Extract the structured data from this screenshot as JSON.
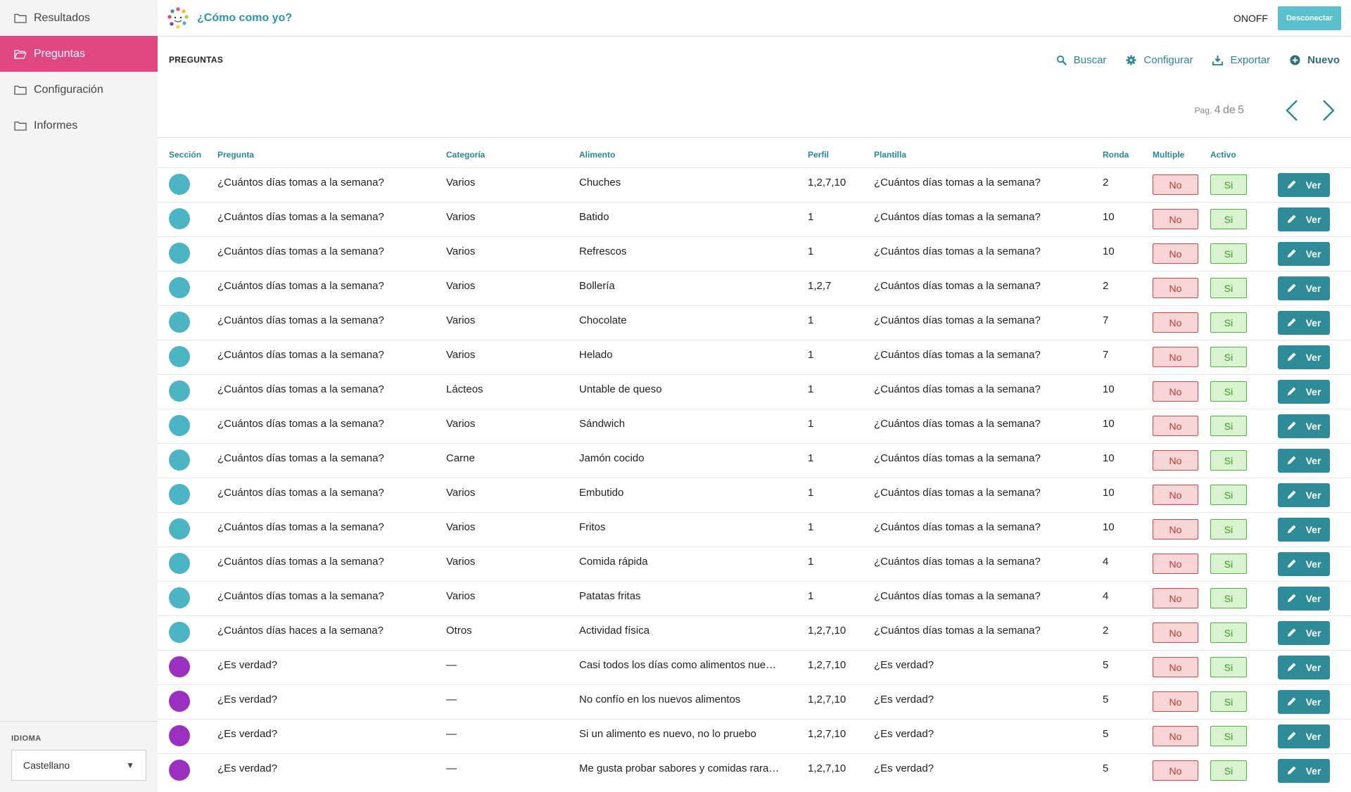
{
  "sidebar": {
    "items": [
      {
        "label": "Resultados",
        "active": false
      },
      {
        "label": "Preguntas",
        "active": true
      },
      {
        "label": "Configuración",
        "active": false
      },
      {
        "label": "Informes",
        "active": false
      }
    ],
    "language_label": "IDIOMA",
    "language_value": "Castellano"
  },
  "header": {
    "app_title": "¿Cómo como yo?",
    "onoff": "ONOFF",
    "disconnect_label": "Desconectar"
  },
  "section": {
    "title": "PREGUNTAS",
    "actions": {
      "search": "Buscar",
      "configure": "Configurar",
      "export": "Exportar",
      "new": "Nuevo"
    }
  },
  "pager": {
    "prefix": "Pag.",
    "current": "4",
    "of": "de",
    "total": "5"
  },
  "colors": {
    "accent": "#2a8796",
    "active_nav": "#e04680",
    "section_teal": "#4bb5c4",
    "section_purple": "#9b30c0"
  },
  "table": {
    "columns": [
      "Sección",
      "Pregunta",
      "Categoría",
      "Alimento",
      "Perfil",
      "Plantilla",
      "Ronda",
      "Multiple",
      "Activo",
      ""
    ],
    "no_label": "No",
    "si_label": "Si",
    "ver_label": "Ver",
    "rows": [
      {
        "color": "#4bb5c4",
        "pregunta": "¿Cuántos días tomas a la semana?",
        "categoria": "Varios",
        "alimento": "Chuches",
        "perfil": "1,2,7,10",
        "plantilla": "¿Cuántos días tomas a la semana?",
        "ronda": "2"
      },
      {
        "color": "#4bb5c4",
        "pregunta": "¿Cuántos días tomas a la semana?",
        "categoria": "Varios",
        "alimento": "Batido",
        "perfil": "1",
        "plantilla": "¿Cuántos días tomas a la semana?",
        "ronda": "10"
      },
      {
        "color": "#4bb5c4",
        "pregunta": "¿Cuántos días tomas a la semana?",
        "categoria": "Varios",
        "alimento": "Refrescos",
        "perfil": "1",
        "plantilla": "¿Cuántos días tomas a la semana?",
        "ronda": "10"
      },
      {
        "color": "#4bb5c4",
        "pregunta": "¿Cuántos días tomas a la semana?",
        "categoria": "Varios",
        "alimento": "Bollería",
        "perfil": "1,2,7",
        "plantilla": "¿Cuántos días tomas a la semana?",
        "ronda": "2"
      },
      {
        "color": "#4bb5c4",
        "pregunta": "¿Cuántos días tomas a la semana?",
        "categoria": "Varios",
        "alimento": "Chocolate",
        "perfil": "1",
        "plantilla": "¿Cuántos días tomas a la semana?",
        "ronda": "7"
      },
      {
        "color": "#4bb5c4",
        "pregunta": "¿Cuántos días tomas a la semana?",
        "categoria": "Varios",
        "alimento": "Helado",
        "perfil": "1",
        "plantilla": "¿Cuántos días tomas a la semana?",
        "ronda": "7"
      },
      {
        "color": "#4bb5c4",
        "pregunta": "¿Cuántos días tomas a la semana?",
        "categoria": "Lácteos",
        "alimento": "Untable de queso",
        "perfil": "1",
        "plantilla": "¿Cuántos días tomas a la semana?",
        "ronda": "10"
      },
      {
        "color": "#4bb5c4",
        "pregunta": "¿Cuántos días tomas a la semana?",
        "categoria": "Varios",
        "alimento": "Sándwich",
        "perfil": "1",
        "plantilla": "¿Cuántos días tomas a la semana?",
        "ronda": "10"
      },
      {
        "color": "#4bb5c4",
        "pregunta": "¿Cuántos días tomas a la semana?",
        "categoria": "Carne",
        "alimento": "Jamón cocido",
        "perfil": "1",
        "plantilla": "¿Cuántos días tomas a la semana?",
        "ronda": "10"
      },
      {
        "color": "#4bb5c4",
        "pregunta": "¿Cuántos días tomas a la semana?",
        "categoria": "Varios",
        "alimento": "Embutido",
        "perfil": "1",
        "plantilla": "¿Cuántos días tomas a la semana?",
        "ronda": "10"
      },
      {
        "color": "#4bb5c4",
        "pregunta": "¿Cuántos días tomas a la semana?",
        "categoria": "Varios",
        "alimento": "Fritos",
        "perfil": "1",
        "plantilla": "¿Cuántos días tomas a la semana?",
        "ronda": "10"
      },
      {
        "color": "#4bb5c4",
        "pregunta": "¿Cuántos días tomas a la semana?",
        "categoria": "Varios",
        "alimento": "Comida rápida",
        "perfil": "1",
        "plantilla": "¿Cuántos días tomas a la semana?",
        "ronda": "4"
      },
      {
        "color": "#4bb5c4",
        "pregunta": "¿Cuántos días tomas a la semana?",
        "categoria": "Varios",
        "alimento": "Patatas fritas",
        "perfil": "1",
        "plantilla": "¿Cuántos días tomas a la semana?",
        "ronda": "4"
      },
      {
        "color": "#4bb5c4",
        "pregunta": "¿Cuántos días haces a la semana?",
        "categoria": "Otros",
        "alimento": "Actividad física",
        "perfil": "1,2,7,10",
        "plantilla": "¿Cuántos días tomas a la semana?",
        "ronda": "2"
      },
      {
        "color": "#9b30c0",
        "pregunta": "¿Es verdad?",
        "categoria": "—",
        "alimento": "Casi todos los días como alimentos nue…",
        "perfil": "1,2,7,10",
        "plantilla": "¿Es verdad?",
        "ronda": "5"
      },
      {
        "color": "#9b30c0",
        "pregunta": "¿Es verdad?",
        "categoria": "—",
        "alimento": "No confío en los nuevos alimentos",
        "perfil": "1,2,7,10",
        "plantilla": "¿Es verdad?",
        "ronda": "5"
      },
      {
        "color": "#9b30c0",
        "pregunta": "¿Es verdad?",
        "categoria": "—",
        "alimento": "Si un alimento es nuevo, no lo pruebo",
        "perfil": "1,2,7,10",
        "plantilla": "¿Es verdad?",
        "ronda": "5"
      },
      {
        "color": "#9b30c0",
        "pregunta": "¿Es verdad?",
        "categoria": "—",
        "alimento": "Me gusta probar sabores y comidas rara…",
        "perfil": "1,2,7,10",
        "plantilla": "¿Es verdad?",
        "ronda": "5"
      }
    ]
  }
}
